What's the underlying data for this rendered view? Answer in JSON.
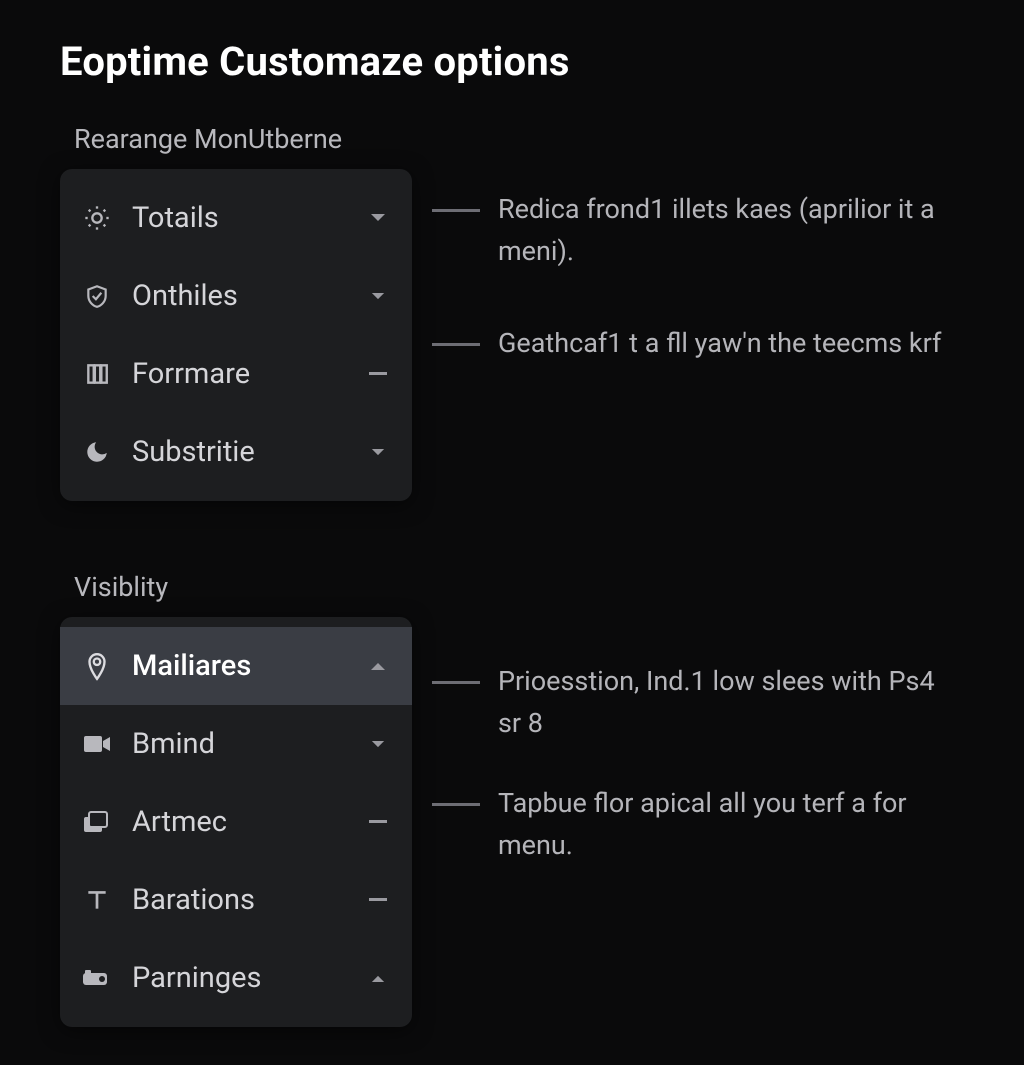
{
  "title": "Eoptime Customaze options",
  "sections": [
    {
      "label": "Rearange MonUtberne",
      "items": [
        {
          "icon": "sun-icon",
          "label": "Totails",
          "control": "chevron-down",
          "selected": false
        },
        {
          "icon": "check-circle-icon",
          "label": "Onthiles",
          "control": "chevron-down",
          "selected": false
        },
        {
          "icon": "columns-icon",
          "label": "Forrmare",
          "control": "minus",
          "selected": false
        },
        {
          "icon": "moon-icon",
          "label": "Substritie",
          "control": "chevron-down",
          "selected": false
        }
      ],
      "notes": [
        {
          "text": "Redica frond1 illets kaes (aprilior it a meni).",
          "offset": 20
        },
        {
          "text": "Geathcaf1 t a fll yaw'n the teecms krf",
          "offset": 50
        }
      ]
    },
    {
      "label": "Visiblity",
      "items": [
        {
          "icon": "pin-icon",
          "label": "Mailiares",
          "control": "chevron-up",
          "selected": true
        },
        {
          "icon": "video-icon",
          "label": "Bmind",
          "control": "chevron-down",
          "selected": false
        },
        {
          "icon": "stack-icon",
          "label": "Artmec",
          "control": "minus",
          "selected": false
        },
        {
          "icon": "text-icon",
          "label": "Barations",
          "control": "minus",
          "selected": false
        },
        {
          "icon": "camera-icon",
          "label": "Parninges",
          "control": "chevron-up",
          "selected": false
        }
      ],
      "notes": [
        {
          "text": "Prioesstion, Ind.1 low slees with Ps4 sr 8",
          "offset": 44
        },
        {
          "text": "Tapbue flor apical all you terf a for menu.",
          "offset": 38
        }
      ]
    }
  ]
}
